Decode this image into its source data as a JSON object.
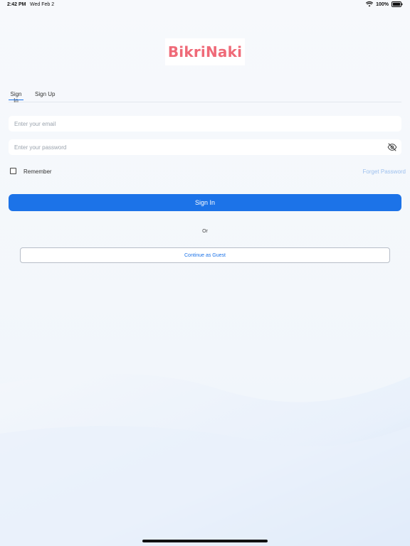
{
  "status_bar": {
    "time": "2:42 PM",
    "date": "Wed Feb 2",
    "battery": "100%",
    "icons": [
      "wifi-icon",
      "battery-icon"
    ]
  },
  "logo": {
    "text": "BikriNaki",
    "color": "#ef6a78"
  },
  "tabs": [
    {
      "label": "Sign In",
      "active": true
    },
    {
      "label": "Sign Up",
      "active": false
    }
  ],
  "form": {
    "email": {
      "placeholder": "Enter your email",
      "value": ""
    },
    "password": {
      "placeholder": "Enter your password",
      "value": "",
      "toggle_icon": "eye-off-icon"
    },
    "remember_label": "Remember",
    "remember_checked": false,
    "forget_password": "Forget Password",
    "submit_label": "Sign In"
  },
  "divider_text": "Or",
  "guest_button": "Continue as Guest",
  "colors": {
    "primary": "#1c73e8",
    "link_light": "#9ec1ee",
    "logo": "#ef6a78"
  }
}
